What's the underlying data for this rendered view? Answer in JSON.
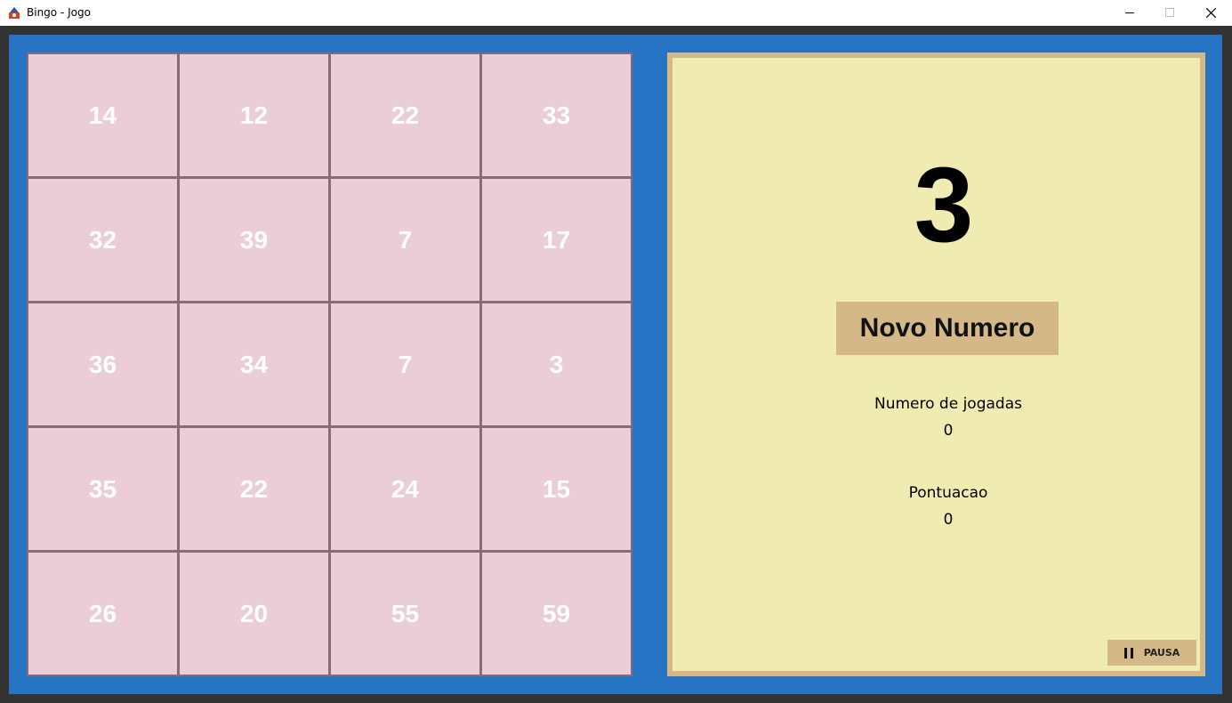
{
  "window": {
    "title": "Bingo - Jogo",
    "icon": "java-app-icon",
    "controls": [
      "minimize",
      "maximize",
      "close"
    ]
  },
  "card": {
    "cells": [
      "14",
      "12",
      "22",
      "33",
      "32",
      "39",
      "7",
      "17",
      "36",
      "34",
      "7",
      "3",
      "35",
      "22",
      "24",
      "15",
      "26",
      "20",
      "55",
      "59"
    ]
  },
  "draw": {
    "current_number": "3",
    "new_number_button": "Novo Numero"
  },
  "stats": {
    "plays_label": "Numero de jogadas",
    "plays_value": "0",
    "score_label": "Pontuacao",
    "score_value": "0"
  },
  "pause": {
    "label": "PAUSA",
    "icon": "pause-icon"
  },
  "colors": {
    "background_blue": "#2773c4",
    "cell_pink": "#ebcdd8",
    "cell_border": "#8a6a78",
    "side_panel": "#f0ebb0",
    "button_tan": "#d4b888"
  }
}
